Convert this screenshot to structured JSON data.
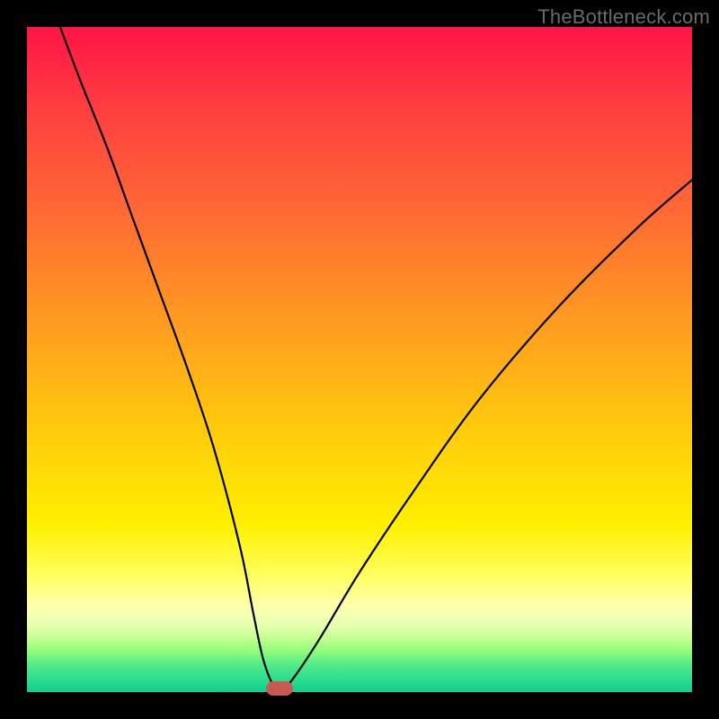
{
  "watermark": "TheBottleneck.com",
  "chart_data": {
    "type": "line",
    "title": "",
    "xlabel": "",
    "ylabel": "",
    "xlim": [
      0,
      100
    ],
    "ylim": [
      0,
      100
    ],
    "grid": false,
    "legend": false,
    "series": [
      {
        "name": "bottleneck-curve",
        "x": [
          5,
          8,
          12,
          16,
          20,
          24,
          28,
          32,
          34,
          35.5,
          37,
          38,
          40,
          44,
          50,
          58,
          68,
          80,
          92,
          100
        ],
        "y": [
          100,
          92,
          82,
          71,
          60,
          49,
          37,
          22,
          12,
          5,
          1,
          0,
          2,
          8,
          18,
          30,
          44,
          58,
          70,
          77
        ]
      }
    ],
    "minimum_marker": {
      "x": 38,
      "y": 0
    },
    "background_gradient": {
      "top": "#ff1445",
      "bottom": "#0ed090",
      "stops": [
        "#ff1445",
        "#ff6a35",
        "#ffcf0a",
        "#ffff66",
        "#8afc7a",
        "#0ed090"
      ]
    }
  }
}
